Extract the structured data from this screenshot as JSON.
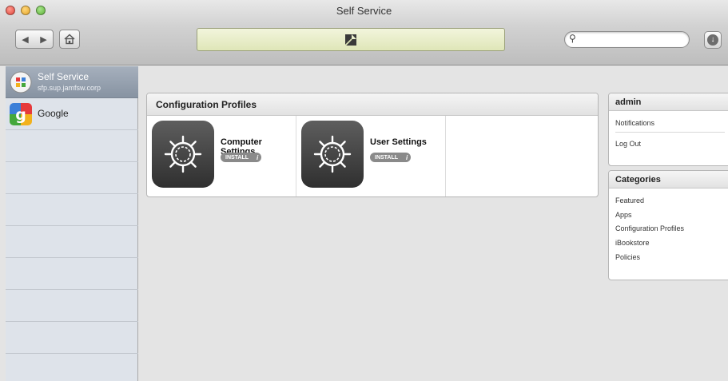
{
  "window": {
    "title": "Self Service"
  },
  "toolbar": {
    "back_icon": "back-arrow-icon",
    "forward_icon": "forward-arrow-icon",
    "home_icon": "home-icon",
    "search_placeholder": "",
    "download_icon": "download-icon"
  },
  "sidebar": {
    "items": [
      {
        "name": "Self Service",
        "subtitle": "sfp.sup.jamfsw.corp",
        "icon": "self-service-icon",
        "selected": true
      },
      {
        "name": "Google",
        "icon": "google-icon",
        "selected": false
      }
    ]
  },
  "main": {
    "section_title": "Configuration Profiles",
    "items": [
      {
        "title": "Computer Settings",
        "action": "INSTALL",
        "icon": "gear-icon"
      },
      {
        "title": "User Settings",
        "action": "INSTALL",
        "icon": "gear-icon"
      }
    ]
  },
  "account": {
    "title": "admin",
    "links": [
      "Notifications",
      "Log Out"
    ]
  },
  "categories": {
    "title": "Categories",
    "links": [
      "Featured",
      "Apps",
      "Configuration Profiles",
      "iBookstore",
      "Policies"
    ]
  },
  "colors": {
    "sidebar_selected": "#8f9aa8",
    "sidebar_bg": "#dee3ea",
    "install_badge": "#8a8a8a",
    "progress_well": "#e6ecc4"
  }
}
